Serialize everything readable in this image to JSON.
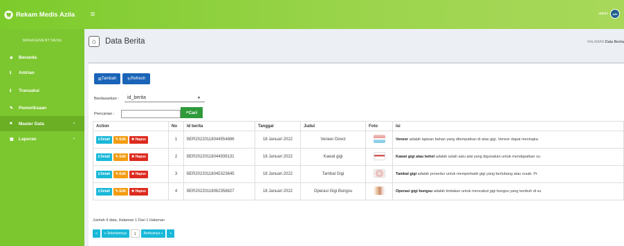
{
  "app": {
    "brand": "Rekam Medis Azila",
    "user_name": "admin",
    "user_initials": "ARI"
  },
  "sidebar": {
    "heading": "MANAGEMENT MENU",
    "items": [
      {
        "label": "Beranda",
        "icon": "dashboard-icon"
      },
      {
        "label": "Antrian",
        "icon": "info-icon"
      },
      {
        "label": "Transaksi",
        "icon": "info-icon"
      },
      {
        "label": "Pemeriksaan",
        "icon": "edit-icon"
      },
      {
        "label": "Master Data",
        "icon": "book-icon"
      },
      {
        "label": "Laporan",
        "icon": "calendar-icon"
      }
    ]
  },
  "header": {
    "title": "Data Berita",
    "breadcrumb_prefix": "HALAMAN",
    "breadcrumb_current": "Data Berita"
  },
  "toolbar": {
    "add_label": "Tambah",
    "refresh_label": "Refresh"
  },
  "filter": {
    "by_label": "Berdasarkan :",
    "by_value": "id_berita",
    "search_label": "Pencarian :",
    "search_value": "",
    "search_button": "Cari"
  },
  "table": {
    "headers": [
      "Action",
      "No",
      "Id berita",
      "Tanggal",
      "Judul",
      "Foto",
      "Isi"
    ],
    "action_labels": {
      "detail": "Detail",
      "edit": "Edit",
      "delete": "Hapus"
    },
    "rows": [
      {
        "no": "1",
        "id": "BER20220118044554886",
        "tanggal": "18 Januari 2022",
        "judul": "Veneer Direct",
        "isi_bold": "Veneer",
        "isi_rest": " adalah lapisan bahan yang ditempatkan di atas gigi. Veneer dapat meningka"
      },
      {
        "no": "2",
        "id": "BER20220118044939131",
        "tanggal": "18 Januari 2022",
        "judul": "Kawat gigi",
        "isi_bold": "Kawat gigi atau behel",
        "isi_rest": " adalah salah satu alat yang digunakan untuk mendapatkan su"
      },
      {
        "no": "3",
        "id": "BER20220118045323645",
        "tanggal": "18 Januari 2022",
        "judul": "Tambal Gigi",
        "isi_bold": "Tambal gigi",
        "isi_rest": " adalah prosedur untuk memperbaiki gigi yang berlubang atau rusak. Pr"
      },
      {
        "no": "4",
        "id": "BER20220118062358827",
        "tanggal": "18 Januari 2022",
        "judul": "Operasi Gigi Bungsu",
        "isi_bold": "Operasi gigi bungsu",
        "isi_rest": " adalah tindakan untuk mencabut gigi bungsu yang tumbuh di su"
      }
    ]
  },
  "summary": "Jumlah 4 data, Halaman 1 Dari 1 Halaman",
  "pagination": {
    "first": "«",
    "prev": "« Sebelumnya",
    "current": "1",
    "next": "Berikutnya »",
    "last": "»"
  },
  "colors": {
    "accent": "#7cc62f",
    "primary": "#1a64b8",
    "info": "#1ab8d8",
    "warning": "#f39c12",
    "danger": "#dd2b1f",
    "success": "#2e9a3a"
  }
}
